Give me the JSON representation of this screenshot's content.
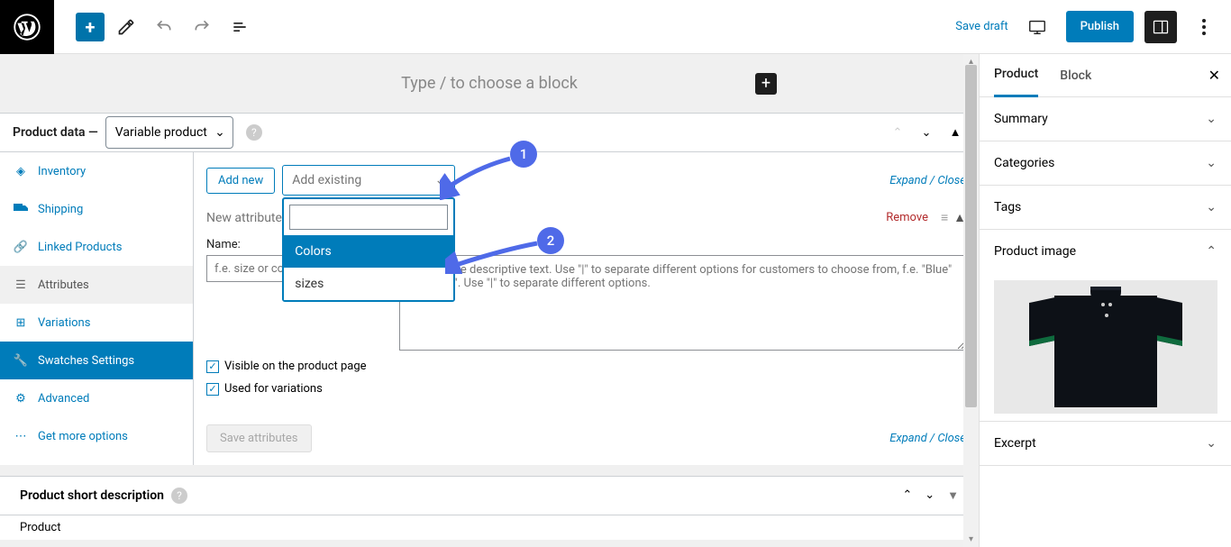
{
  "topbar": {
    "save_draft": "Save draft",
    "publish": "Publish"
  },
  "editor": {
    "placeholder": "Type / to choose a block"
  },
  "product_data": {
    "label": "Product data —",
    "select_value": "Variable product"
  },
  "tabs": {
    "inventory": "Inventory",
    "shipping": "Shipping",
    "linked": "Linked Products",
    "attributes": "Attributes",
    "variations": "Variations",
    "swatches": "Swatches Settings",
    "advanced": "Advanced",
    "get_more": "Get more options"
  },
  "attributes_panel": {
    "add_new": "Add new",
    "add_existing_placeholder": "Add existing",
    "expand_collapse": "Expand / Close",
    "new_attribute": "New attribute",
    "remove": "Remove",
    "name_label": "Name:",
    "name_placeholder": "f.e. size or color",
    "value_placeholder": "Enter some descriptive text. Use \"|\" to separate different options for customers to choose from, f.e. \"Blue\" or \"Large\". Use \"|\" to separate different options.",
    "visible_label": "Visible on the product page",
    "used_variations_label": "Used for variations",
    "save_attrs": "Save attributes",
    "dropdown_options": {
      "colors": "Colors",
      "sizes": "sizes"
    }
  },
  "short_desc": {
    "label": "Product short description"
  },
  "footer": "Product",
  "sidebar": {
    "tab_product": "Product",
    "tab_block": "Block",
    "summary": "Summary",
    "categories": "Categories",
    "tags": "Tags",
    "product_image": "Product image",
    "excerpt": "Excerpt"
  },
  "annotations": {
    "one": "1",
    "two": "2"
  }
}
